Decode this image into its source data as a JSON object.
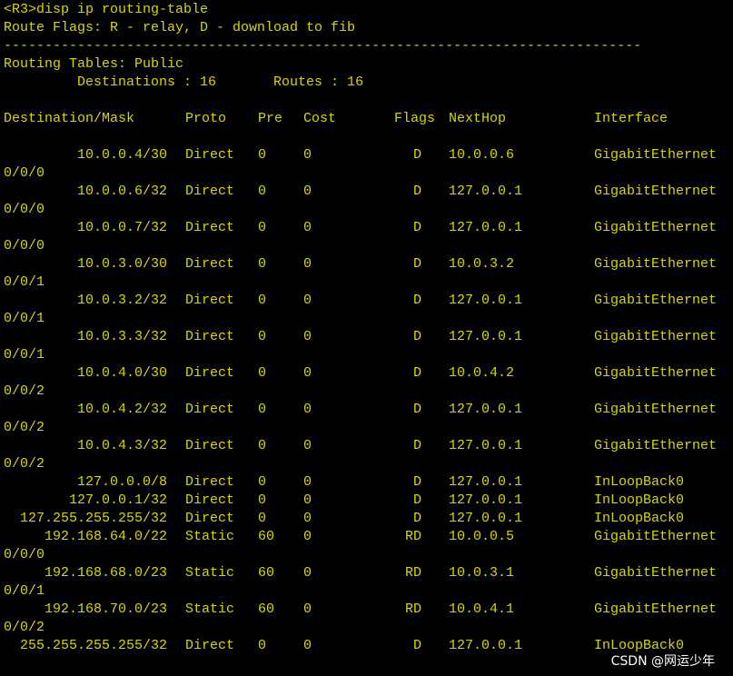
{
  "terminal": {
    "prompt": "<R3>disp ip routing-table",
    "flags_legend": "Route Flags: R - relay, D - download to fib",
    "separator": "------------------------------------------------------------------------------",
    "table_title": "Routing Tables: Public",
    "summary": "         Destinations : 16       Routes : 16",
    "headers": {
      "destination": "Destination/Mask",
      "proto": "Proto",
      "pre": "Pre",
      "cost": "Cost",
      "flags": "Flags",
      "nexthop": "NextHop",
      "interface": "Interface"
    },
    "routes": [
      {
        "dest": "10.0.0.4/30",
        "proto": "Direct",
        "pre": "0",
        "cost": "0",
        "flags": "D",
        "nexthop": "10.0.0.6",
        "iface": "GigabitEthernet",
        "iface_cont": "0/0/0"
      },
      {
        "dest": "10.0.0.6/32",
        "proto": "Direct",
        "pre": "0",
        "cost": "0",
        "flags": "D",
        "nexthop": "127.0.0.1",
        "iface": "GigabitEthernet",
        "iface_cont": "0/0/0"
      },
      {
        "dest": "10.0.0.7/32",
        "proto": "Direct",
        "pre": "0",
        "cost": "0",
        "flags": "D",
        "nexthop": "127.0.0.1",
        "iface": "GigabitEthernet",
        "iface_cont": "0/0/0"
      },
      {
        "dest": "10.0.3.0/30",
        "proto": "Direct",
        "pre": "0",
        "cost": "0",
        "flags": "D",
        "nexthop": "10.0.3.2",
        "iface": "GigabitEthernet",
        "iface_cont": "0/0/1"
      },
      {
        "dest": "10.0.3.2/32",
        "proto": "Direct",
        "pre": "0",
        "cost": "0",
        "flags": "D",
        "nexthop": "127.0.0.1",
        "iface": "GigabitEthernet",
        "iface_cont": "0/0/1"
      },
      {
        "dest": "10.0.3.3/32",
        "proto": "Direct",
        "pre": "0",
        "cost": "0",
        "flags": "D",
        "nexthop": "127.0.0.1",
        "iface": "GigabitEthernet",
        "iface_cont": "0/0/1"
      },
      {
        "dest": "10.0.4.0/30",
        "proto": "Direct",
        "pre": "0",
        "cost": "0",
        "flags": "D",
        "nexthop": "10.0.4.2",
        "iface": "GigabitEthernet",
        "iface_cont": "0/0/2"
      },
      {
        "dest": "10.0.4.2/32",
        "proto": "Direct",
        "pre": "0",
        "cost": "0",
        "flags": "D",
        "nexthop": "127.0.0.1",
        "iface": "GigabitEthernet",
        "iface_cont": "0/0/2"
      },
      {
        "dest": "10.0.4.3/32",
        "proto": "Direct",
        "pre": "0",
        "cost": "0",
        "flags": "D",
        "nexthop": "127.0.0.1",
        "iface": "GigabitEthernet",
        "iface_cont": "0/0/2"
      },
      {
        "dest": "127.0.0.0/8",
        "proto": "Direct",
        "pre": "0",
        "cost": "0",
        "flags": "D",
        "nexthop": "127.0.0.1",
        "iface": "InLoopBack0",
        "iface_cont": ""
      },
      {
        "dest": "127.0.0.1/32",
        "proto": "Direct",
        "pre": "0",
        "cost": "0",
        "flags": "D",
        "nexthop": "127.0.0.1",
        "iface": "InLoopBack0",
        "iface_cont": ""
      },
      {
        "dest": "127.255.255.255/32",
        "proto": "Direct",
        "pre": "0",
        "cost": "0",
        "flags": "D",
        "nexthop": "127.0.0.1",
        "iface": "InLoopBack0",
        "iface_cont": ""
      },
      {
        "dest": "192.168.64.0/22",
        "proto": "Static",
        "pre": "60",
        "cost": "0",
        "flags": "RD",
        "nexthop": "10.0.0.5",
        "iface": "GigabitEthernet",
        "iface_cont": "0/0/0"
      },
      {
        "dest": "192.168.68.0/23",
        "proto": "Static",
        "pre": "60",
        "cost": "0",
        "flags": "RD",
        "nexthop": "10.0.3.1",
        "iface": "GigabitEthernet",
        "iface_cont": "0/0/1"
      },
      {
        "dest": "192.168.70.0/23",
        "proto": "Static",
        "pre": "60",
        "cost": "0",
        "flags": "RD",
        "nexthop": "10.0.4.1",
        "iface": "GigabitEthernet",
        "iface_cont": "0/0/2"
      },
      {
        "dest": "255.255.255.255/32",
        "proto": "Direct",
        "pre": "0",
        "cost": "0",
        "flags": "D",
        "nexthop": "127.0.0.1",
        "iface": "InLoopBack0",
        "iface_cont": ""
      }
    ],
    "text_color": "#d7d700",
    "background": "#000000"
  },
  "watermark": "CSDN @网运少年"
}
